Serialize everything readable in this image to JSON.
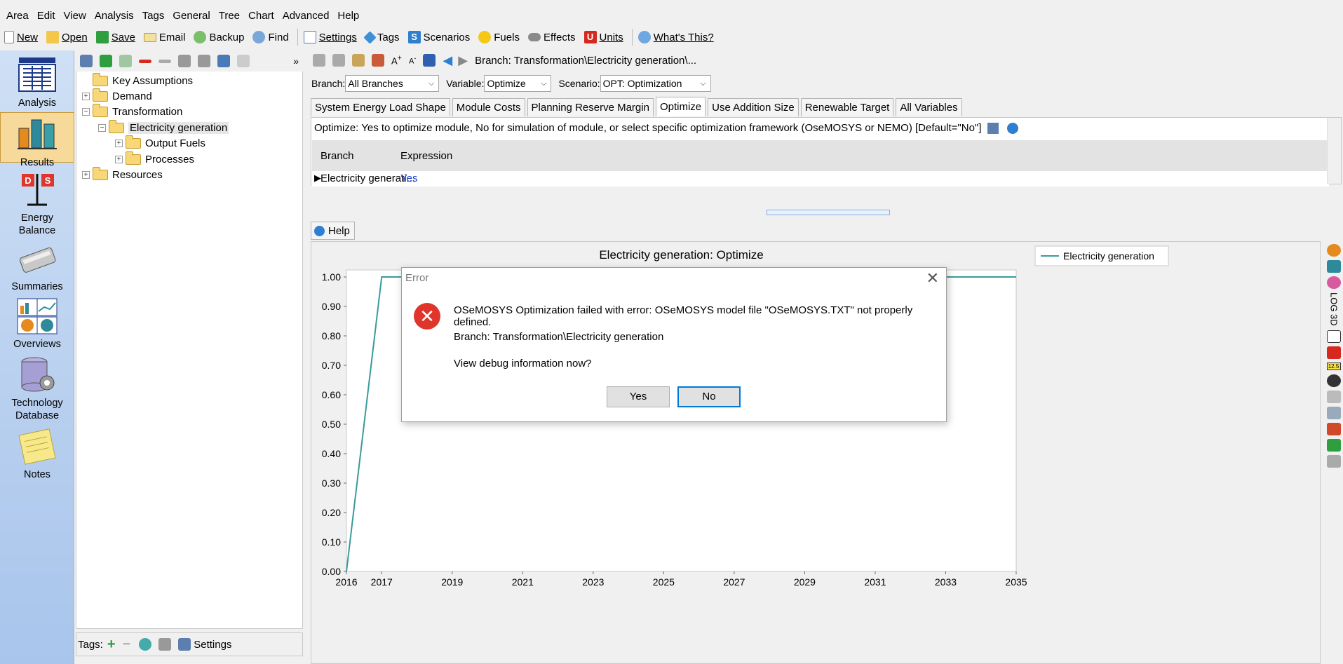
{
  "menu": [
    "Area",
    "Edit",
    "View",
    "Analysis",
    "Tags",
    "General",
    "Tree",
    "Chart",
    "Advanced",
    "Help"
  ],
  "toolbar": {
    "new": "New",
    "open": "Open",
    "save": "Save",
    "email": "Email",
    "backup": "Backup",
    "find": "Find",
    "settings": "Settings",
    "tags": "Tags",
    "scenarios": "Scenarios",
    "fuels": "Fuels",
    "effects": "Effects",
    "units": "Units",
    "whats_this": "What's This?"
  },
  "nav": {
    "analysis": "Analysis",
    "results": "Results",
    "energy_balance": [
      "Energy",
      "Balance"
    ],
    "summaries": "Summaries",
    "overviews": "Overviews",
    "technology_database": [
      "Technology",
      "Database"
    ],
    "notes": "Notes"
  },
  "tree": {
    "key_assumptions": "Key Assumptions",
    "demand": "Demand",
    "transformation": "Transformation",
    "electricity_generation": "Electricity generation",
    "output_fuels": "Output Fuels",
    "processes": "Processes",
    "resources": "Resources"
  },
  "tags_bar": {
    "label": "Tags:",
    "settings": "Settings"
  },
  "content": {
    "breadcrumb": "Branch: Transformation\\Electricity generation\\...",
    "branch_label": "Branch:",
    "branch_value": "All Branches",
    "variable_label": "Variable:",
    "variable_value": "Optimize",
    "scenario_label": "Scenario:",
    "scenario_value": "OPT: Optimization",
    "tabs": [
      "System Energy Load Shape",
      "Module Costs",
      "Planning Reserve Margin",
      "Optimize",
      "Use Addition Size",
      "Renewable Target",
      "All Variables"
    ],
    "description": "Optimize: Yes to optimize module, No for simulation of module, or select specific optimization framework (OseMOSYS or NEMO) [Default=\"No\"]",
    "grid": {
      "col_branch": "Branch",
      "col_expression": "Expression",
      "row_branch": "Electricity generati...",
      "row_expression": "Yes"
    },
    "help": "Help"
  },
  "chart_data": {
    "type": "line",
    "title": "Electricity generation: Optimize",
    "xlabel": "",
    "ylabel": "",
    "x": [
      2016,
      2017,
      2018,
      2019,
      2020,
      2021,
      2022,
      2023,
      2024,
      2025,
      2026,
      2027,
      2028,
      2029,
      2030,
      2031,
      2032,
      2033,
      2034,
      2035
    ],
    "series": [
      {
        "name": "Electricity generation",
        "values": [
          0,
          1,
          1,
          1,
          1,
          1,
          1,
          1,
          1,
          1,
          1,
          1,
          1,
          1,
          1,
          1,
          1,
          1,
          1,
          1
        ],
        "color": "#3a9a9a"
      }
    ],
    "xticks": [
      "2016",
      "2017",
      "2019",
      "2021",
      "2023",
      "2025",
      "2027",
      "2029",
      "2031",
      "2033",
      "2035"
    ],
    "yticks": [
      "0.00",
      "0.10",
      "0.20",
      "0.30",
      "0.40",
      "0.50",
      "0.60",
      "0.70",
      "0.80",
      "0.90",
      "1.00"
    ],
    "ylim": [
      0,
      1
    ],
    "xlim": [
      2016,
      2035
    ],
    "legend": "top-right",
    "grid": false
  },
  "chart_strip": {
    "log": "LOG",
    "threed": "3D",
    "badge": "12.5"
  },
  "dialog": {
    "title": "Error",
    "message": "OSeMOSYS Optimization failed with error: OSeMOSYS model file \"OSeMOSYS.TXT\" not properly defined.",
    "branch": "Branch: Transformation\\Electricity generation",
    "question": "View debug information now?",
    "yes": "Yes",
    "no": "No"
  }
}
